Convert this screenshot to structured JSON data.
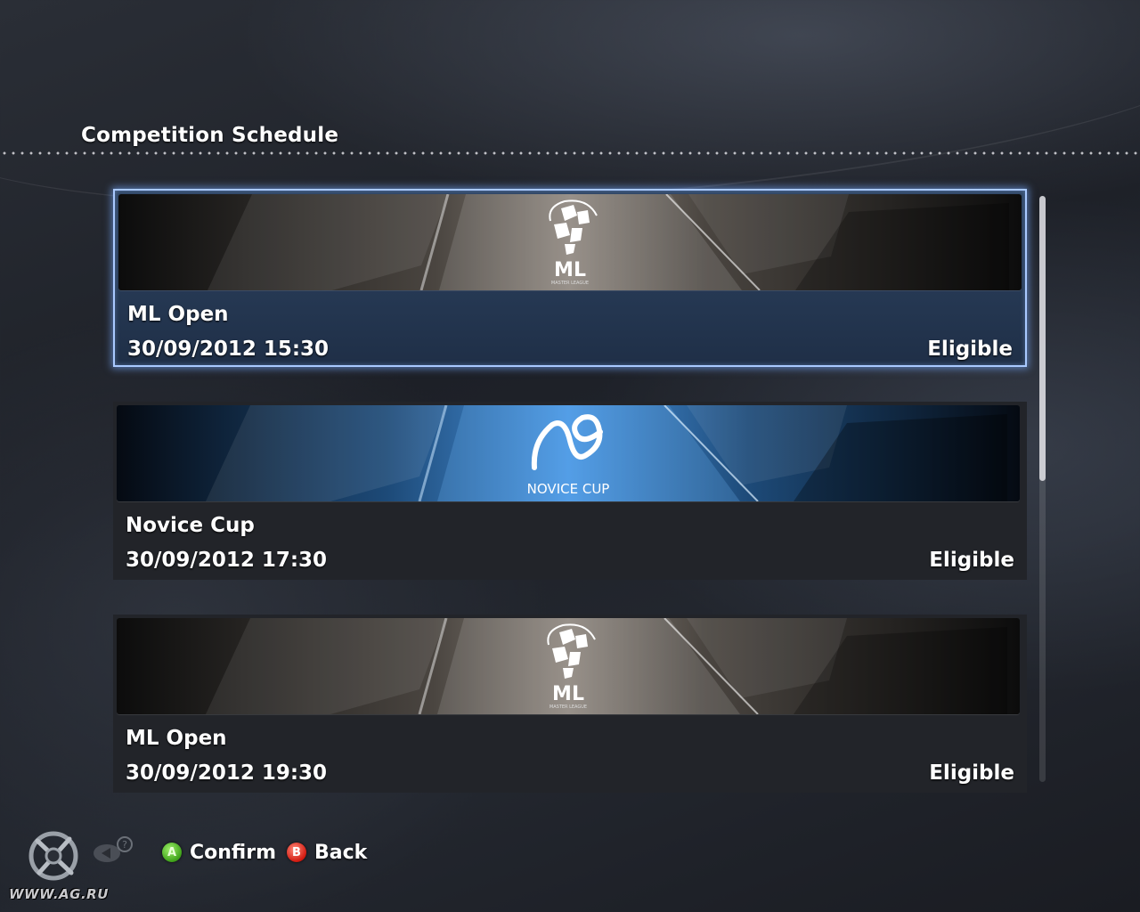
{
  "screen": {
    "title": "Competition Schedule"
  },
  "competitions": [
    {
      "banner_text": "ML",
      "banner_sub": "MASTER LEAGUE",
      "name": "ML Open",
      "datetime": "30/09/2012 15:30",
      "status": "Eligible",
      "selected": true,
      "theme": "ml"
    },
    {
      "banner_text": "NOVICE CUP",
      "banner_sub": "",
      "name": "Novice Cup",
      "datetime": "30/09/2012 17:30",
      "status": "Eligible",
      "selected": false,
      "theme": "novice"
    },
    {
      "banner_text": "ML",
      "banner_sub": "MASTER LEAGUE",
      "name": "ML Open",
      "datetime": "30/09/2012 19:30",
      "status": "Eligible",
      "selected": false,
      "theme": "ml"
    }
  ],
  "footer": {
    "confirm_button": "A",
    "confirm_label": "Confirm",
    "back_button": "B",
    "back_label": "Back"
  },
  "watermark": "WWW.AG.RU",
  "colors": {
    "highlight": "#a9c9ff",
    "confirm": "#3fa21a",
    "back": "#d21a10"
  }
}
